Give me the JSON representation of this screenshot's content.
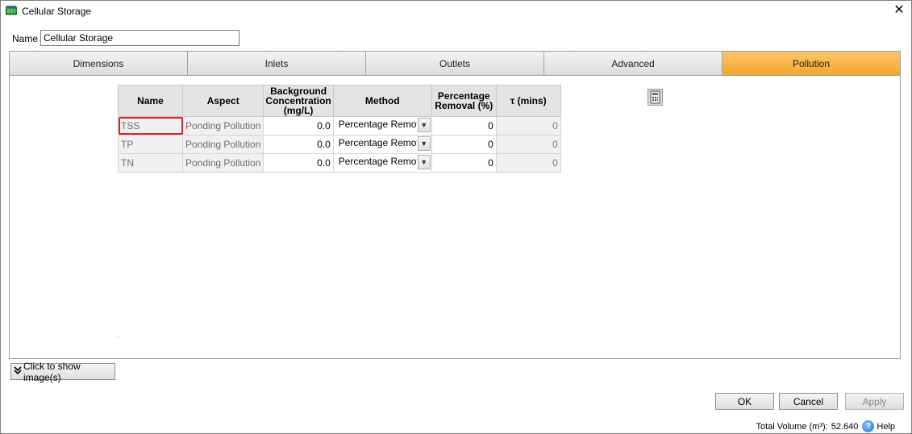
{
  "window": {
    "title": "Cellular Storage",
    "close_glyph": "✕"
  },
  "form": {
    "name_label": "Name",
    "name_value": "Cellular Storage"
  },
  "tabs": [
    {
      "label": "Dimensions"
    },
    {
      "label": "Inlets"
    },
    {
      "label": "Outlets"
    },
    {
      "label": "Advanced"
    },
    {
      "label": "Pollution",
      "active": true
    }
  ],
  "grid": {
    "headers": {
      "name": "Name",
      "aspect": "Aspect",
      "background_l1": "Background",
      "background_l2": "Concentration",
      "background_l3": "(mg/L)",
      "method": "Method",
      "removal_l1": "Percentage",
      "removal_l2": "Removal (%)",
      "tau": "τ (mins)"
    },
    "rows": [
      {
        "name": "TSS",
        "aspect": "Ponding Pollution",
        "background": "0.0",
        "method": "Percentage Removal",
        "removal": "0",
        "tau": "0"
      },
      {
        "name": "TP",
        "aspect": "Ponding Pollution",
        "background": "0.0",
        "method": "Percentage Removal",
        "removal": "0",
        "tau": "0"
      },
      {
        "name": "TN",
        "aspect": "Ponding Pollution",
        "background": "0.0",
        "method": "Percentage Removal",
        "removal": "0",
        "tau": "0"
      }
    ],
    "selected_row": 0
  },
  "icons": {
    "app": "cellular-storage-icon",
    "calculator": "calculator-icon",
    "dropdown": "chevron-down-icon",
    "expand": "double-chevron-down-icon",
    "help": "help-icon"
  },
  "panel": {
    "marker": "."
  },
  "buttons": {
    "show_images": "Click to show image(s)",
    "ok": "OK",
    "cancel": "Cancel",
    "apply": "Apply"
  },
  "status": {
    "total_volume_label": "Total Volume (m³):",
    "total_volume_value": "52.640",
    "help": "Help"
  },
  "colors": {
    "active_tab": "#f4a52d",
    "selection_border": "#e0222c",
    "help_icon": "#2276d4"
  }
}
